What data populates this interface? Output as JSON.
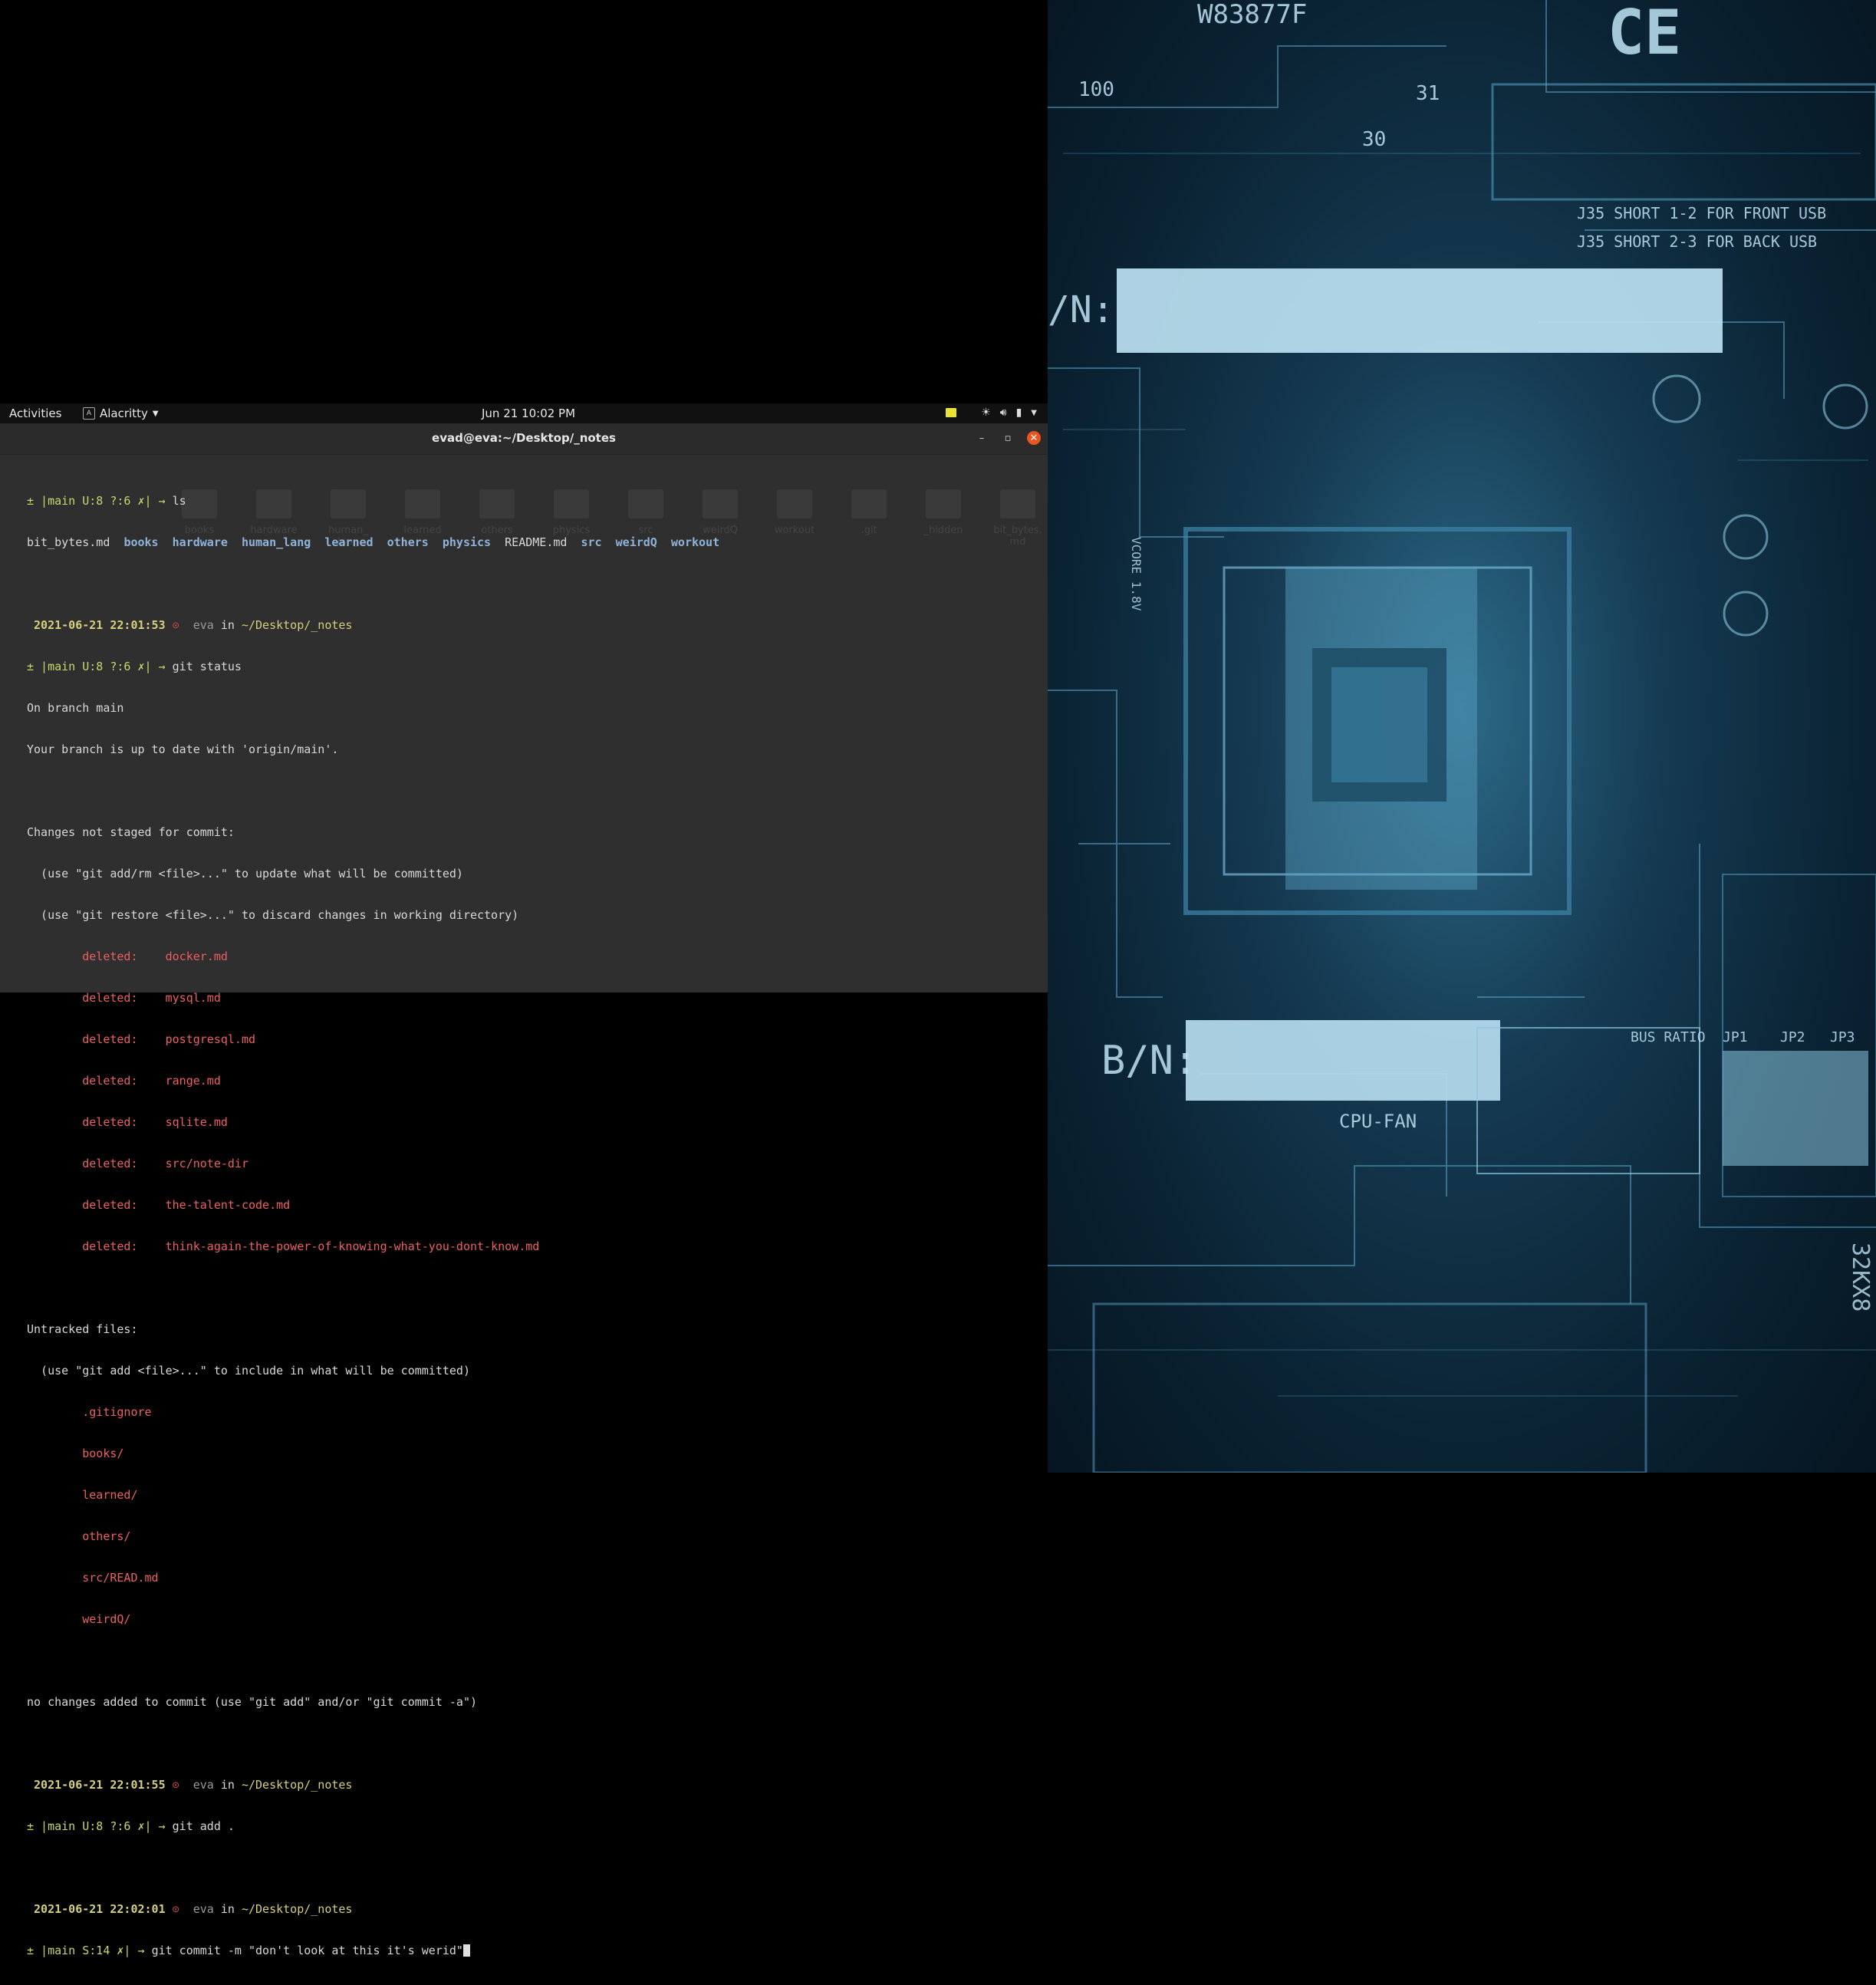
{
  "topbar": {
    "activities": "Activities",
    "app_name": "Alacritty",
    "clock": "Jun 21  10:02 PM"
  },
  "window": {
    "title": "evad@eva:~/Desktop/_notes"
  },
  "ghost_folders": [
    "books",
    "hardware",
    "human_\nlang",
    "learned",
    "others",
    "physics",
    "src",
    "weirdQ",
    "workout",
    ".git",
    "_hidden",
    "bit_bytes.\nmd"
  ],
  "terminal": {
    "l1_prompt": "± |main U:8 ?:6 ✗| → ",
    "l1_cmd": "ls",
    "ls_file1": "bit_bytes.md",
    "ls_dirs": [
      "books",
      "hardware",
      "human_lang",
      "learned",
      "others",
      "physics"
    ],
    "ls_file2": "README.md",
    "ls_dirs2": [
      "src",
      "weirdQ",
      "workout"
    ],
    "ts1": "2021-06-21 22:01:53",
    "ts_icon": "⊙",
    "user": "eva",
    "in_word": "in",
    "path": "~/Desktop/_notes",
    "l2_prompt": "± |main U:8 ?:6 ✗| → ",
    "l2_cmd": "git status",
    "s1": "On branch main",
    "s2": "Your branch is up to date with 'origin/main'.",
    "s3": "Changes not staged for commit:",
    "s4": "  (use \"git add/rm <file>...\" to update what will be committed)",
    "s5": "  (use \"git restore <file>...\" to discard changes in working directory)",
    "deleted_label": "deleted:",
    "deleted": [
      "docker.md",
      "mysql.md",
      "postgresql.md",
      "range.md",
      "sqlite.md",
      "src/note-dir",
      "the-talent-code.md",
      "think-again-the-power-of-knowing-what-you-dont-know.md"
    ],
    "u1": "Untracked files:",
    "u2": "  (use \"git add <file>...\" to include in what will be committed)",
    "untracked": [
      ".gitignore",
      "books/",
      "learned/",
      "others/",
      "src/READ.md",
      "weirdQ/"
    ],
    "nochange": "no changes added to commit (use \"git add\" and/or \"git commit -a\")",
    "ts2": "2021-06-21 22:01:55",
    "l3_prompt": "± |main U:8 ?:6 ✗| → ",
    "l3_cmd": "git add .",
    "ts3": "2021-06-21 22:02:01",
    "l4_prompt": "± |main S:14 ✗| → ",
    "l4_cmd": "git commit -m \"don't look at this it's werid\""
  },
  "wallpaper": {
    "labels": [
      "W83877F",
      "CE",
      "J35 SHORT 1-2 FOR FRONT USB",
      "J35 SHORT 2-3 FOR BACK USB",
      "S/N:",
      "B/N:",
      "CPU-FAN",
      "VCORE 1.8V",
      "BUS RATIO",
      "JP1",
      "JP2",
      "JP3",
      "32KX8",
      "100",
      "31",
      "30"
    ]
  },
  "colors": {
    "accent_close": "#e9541f",
    "notes_indicator": "#e9e433",
    "terminal_bg": "#2f2f2f"
  }
}
